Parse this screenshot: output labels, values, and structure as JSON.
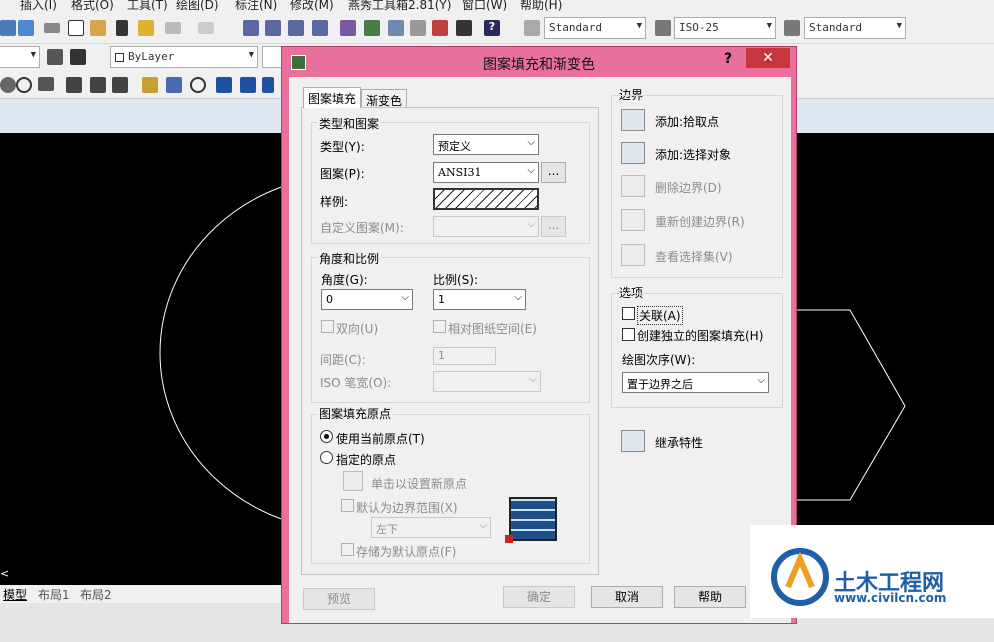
{
  "menubar": {
    "items": [
      "插入(I)",
      "格式(O)",
      "工具(T)",
      "绘图(D)",
      "标注(N)",
      "修改(M)",
      "燕秀工具箱2.81(Y)",
      "窗口(W)",
      "帮助(H)"
    ]
  },
  "toolbar": {
    "text_style": "Standard",
    "dim_style": "ISO-25",
    "table_style": "Standard",
    "layer": "ByLayer"
  },
  "layout_tabs": [
    "模型",
    "布局1",
    "布局2"
  ],
  "dialog": {
    "title": "图案填充和渐变色",
    "help_glyph": "?",
    "close_glyph": "✕",
    "tabs": [
      "图案填充",
      "渐变色"
    ],
    "type_pattern": {
      "title": "类型和图案",
      "type_label": "类型(Y):",
      "type_value": "预定义",
      "pattern_label": "图案(P):",
      "pattern_value": "ANSI31",
      "browse_label": "...",
      "sample_label": "样例:",
      "custom_label": "自定义图案(M):",
      "custom_browse": "..."
    },
    "angle_scale": {
      "title": "角度和比例",
      "angle_label": "角度(G):",
      "angle_value": "0",
      "scale_label": "比例(S):",
      "scale_value": "1",
      "double_label": "双向(U)",
      "relative_label": "相对图纸空间(E)",
      "spacing_label": "间距(C):",
      "spacing_value": "1",
      "iso_label": "ISO 笔宽(O):"
    },
    "origin": {
      "title": "图案填充原点",
      "use_current": "使用当前原点(T)",
      "specified": "指定的原点",
      "click_set": "单击以设置新原点",
      "default_extents": "默认为边界范围(X)",
      "position_value": "左下",
      "store_default": "存储为默认原点(F)"
    },
    "boundaries": {
      "title": "边界",
      "add_pick": "添加:拾取点",
      "add_select": "添加:选择对象",
      "remove": "删除边界(D)",
      "recreate": "重新创建边界(R)",
      "view_sel": "查看选择集(V)"
    },
    "options": {
      "title": "选项",
      "assoc": "关联(A)",
      "separate": "创建独立的图案填充(H)",
      "draw_order_label": "绘图次序(W):",
      "draw_order_value": "置于边界之后"
    },
    "inherit": "继承特性",
    "buttons": {
      "preview": "预览",
      "ok": "确定",
      "cancel": "取消",
      "help": "帮助"
    }
  },
  "watermark": {
    "title": "土木工程网",
    "url": "www.civilcn.com"
  },
  "colors": {
    "dialog_frame": "#e9709c",
    "close": "#c7363e",
    "canvas": "#000000"
  }
}
